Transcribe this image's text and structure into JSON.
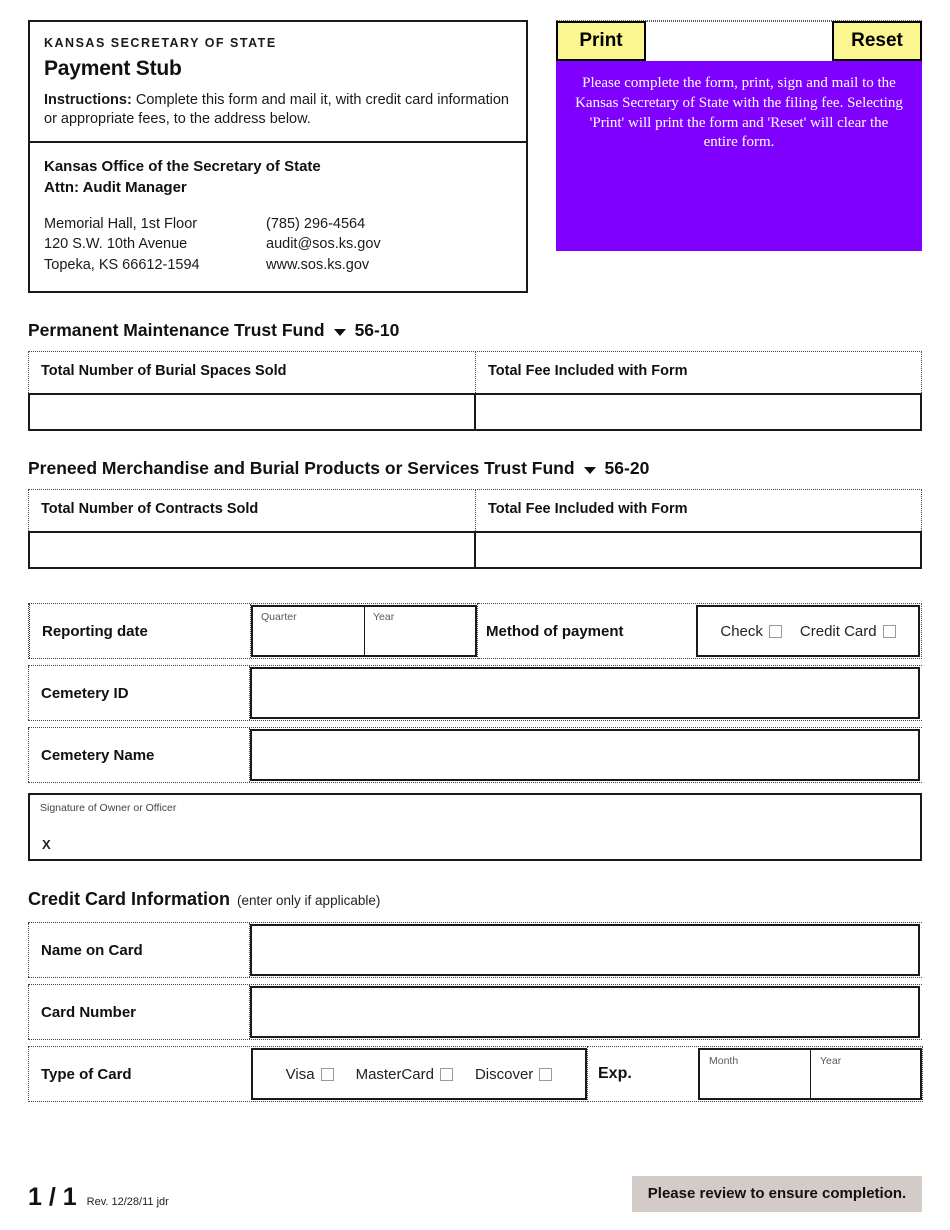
{
  "header": {
    "agency": "KANSAS SECRETARY OF STATE",
    "form_title": "Payment Stub",
    "instructions_lead": "Instructions:",
    "instructions_text": " Complete this form and mail it, with credit card information or appropriate fees, to the address below.",
    "address": {
      "org_line1": "Kansas Office of the Secretary of State",
      "org_line2": "Attn: Audit Manager",
      "street1": "Memorial Hall, 1st Floor",
      "street2": "120 S.W. 10th Avenue",
      "street3": "Topeka, KS 66612-1594",
      "phone": "(785) 296-4564",
      "email": "audit@sos.ks.gov",
      "website": "www.sos.ks.gov"
    }
  },
  "toolbar": {
    "print_label": "Print",
    "reset_label": "Reset",
    "notice": "Please complete the form, print, sign and mail to the Kansas Secretary of State with the filing fee.  Selecting 'Print' will print the form and 'Reset' will clear the entire form.",
    "notice_bg": "#8000ff",
    "button_bg": "#fbf68f"
  },
  "funds": [
    {
      "title": "Permanent Maintenance Trust Fund",
      "code": "56-10",
      "col1_header": "Total Number of Burial Spaces Sold",
      "col2_header": "Total Fee Included with Form",
      "col1_value": "",
      "col2_value": ""
    },
    {
      "title": "Preneed Merchandise and Burial Products or Services Trust Fund",
      "code": "56-20",
      "col1_header": "Total Number of Contracts Sold",
      "col2_header": "Total Fee Included with Form",
      "col1_value": "",
      "col2_value": ""
    }
  ],
  "details": {
    "reporting_date_label": "Reporting date",
    "quarter_label": "Quarter",
    "quarter_value": "",
    "year_label": "Year",
    "year_value": "",
    "method_of_payment_label": "Method of payment",
    "check_option": "Check",
    "credit_card_option": "Credit Card",
    "cemetery_id_label": "Cemetery ID",
    "cemetery_id_value": "",
    "cemetery_name_label": "Cemetery Name",
    "cemetery_name_value": "",
    "signature_caption": "Signature of Owner or Officer",
    "signature_mark": "X",
    "signature_value": ""
  },
  "credit_card": {
    "section_title": "Credit Card Information",
    "section_note": "(enter only if applicable)",
    "name_on_card_label": "Name on Card",
    "name_on_card_value": "",
    "card_number_label": "Card Number",
    "card_number_value": "",
    "type_of_card_label": "Type of Card",
    "visa_option": "Visa",
    "mastercard_option": "MasterCard",
    "discover_option": "Discover",
    "exp_label": "Exp.",
    "exp_month_label": "Month",
    "exp_month_value": "",
    "exp_year_label": "Year",
    "exp_year_value": ""
  },
  "footer": {
    "page_number": "1 / 1",
    "revision": "Rev. 12/28/11 jdr",
    "review_notice": "Please review to ensure completion.",
    "review_bg": "#d3cbc8"
  }
}
